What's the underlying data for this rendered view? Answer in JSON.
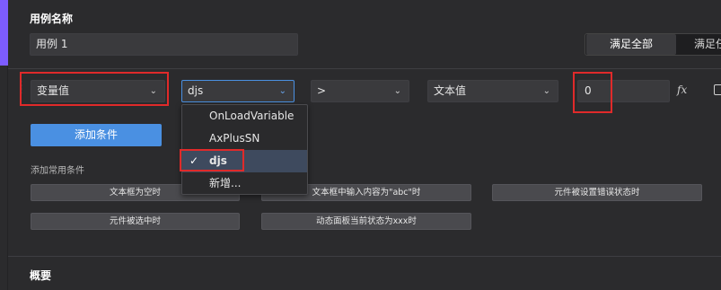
{
  "header": {
    "case_name_label": "用例名称",
    "case_name_value": "用例 1",
    "seg_all": "满足全部",
    "seg_any": "满足任"
  },
  "condition_row": {
    "left_type": "变量值",
    "variable": "djs",
    "operator": ">",
    "right_type": "文本值",
    "value": "0",
    "fx": "fx"
  },
  "dropdown": {
    "options": [
      "OnLoadVariable",
      "AxPlusSN",
      "djs",
      "新增..."
    ],
    "selected": "djs"
  },
  "actions": {
    "add_condition": "添加条件",
    "common_label": "添加常用条件",
    "chips": [
      "文本框为空时",
      "文本框中输入内容为\"abc\"时",
      "元件被设置错误状态时",
      "元件被选中时",
      "动态面板当前状态为xxx时"
    ]
  },
  "footer": {
    "overview": "概要"
  },
  "icons": {
    "drag": "drag-handle-icon",
    "chevron": "chevron-down-icon",
    "fx": "fx-icon",
    "comment": "comment-icon",
    "check": "check-icon"
  },
  "colors": {
    "accent": "#7d5cff",
    "primary": "#4a90e2",
    "highlight": "#e02a2a",
    "background": "#2b2b2d"
  }
}
